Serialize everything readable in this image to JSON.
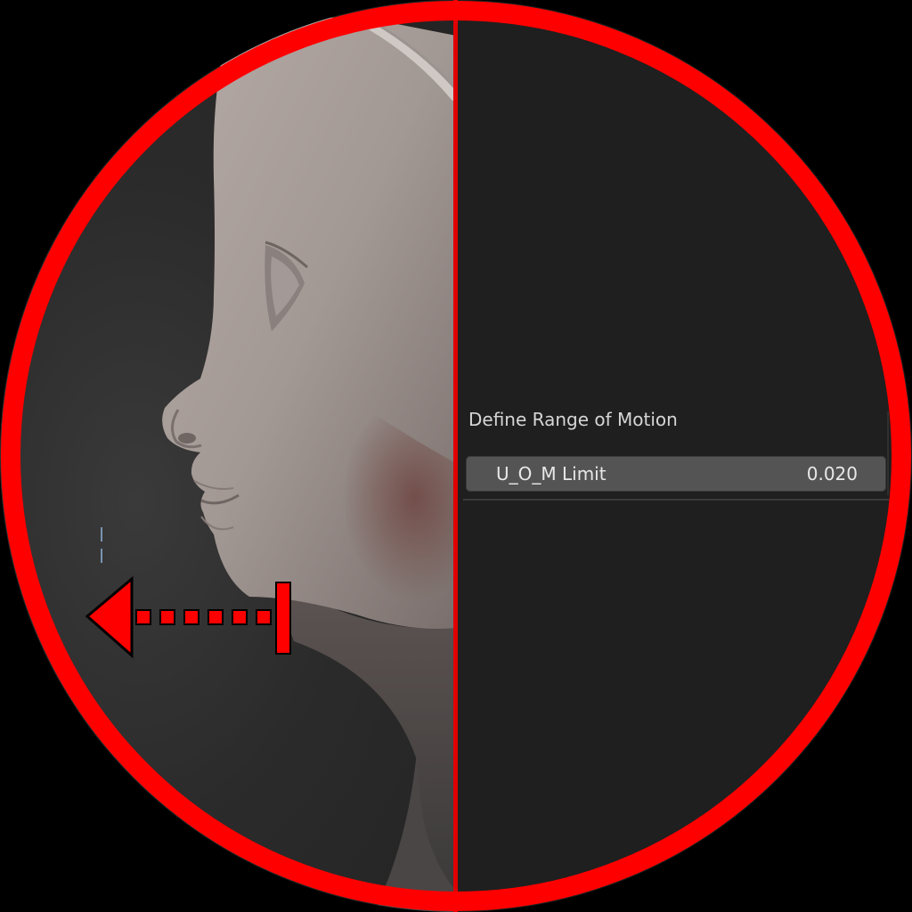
{
  "panel": {
    "section_title": "Define Range of Motion",
    "property": {
      "label": "U_O_M Limit",
      "value": "0.020"
    }
  },
  "overlay": {
    "ring_color": "#ff0000",
    "arrow_color": "#ff0000",
    "arrow_direction": "left",
    "arrow_icon": "dashed-left-arrow-icon"
  }
}
